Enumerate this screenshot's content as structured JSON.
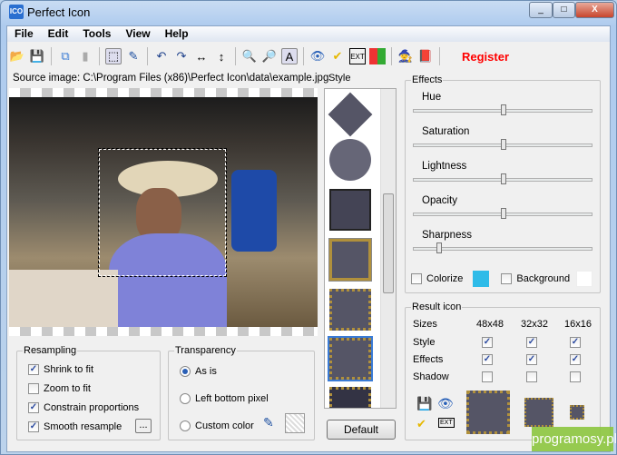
{
  "window": {
    "title": "Perfect Icon",
    "min": "_",
    "max": "□",
    "close": "X"
  },
  "menu": [
    "File",
    "Edit",
    "Tools",
    "View",
    "Help"
  ],
  "toolbar": {
    "register": "Register",
    "register_color": "#ff0000"
  },
  "source": {
    "label": "Source image: C:\\Program Files (x86)\\Perfect Icon\\data\\example.jpg"
  },
  "style": {
    "label": "Style",
    "default_button": "Default"
  },
  "effects": {
    "label": "Effects",
    "sliders": [
      {
        "name": "Hue",
        "value": 50
      },
      {
        "name": "Saturation",
        "value": 50
      },
      {
        "name": "Lightness",
        "value": 50
      },
      {
        "name": "Opacity",
        "value": 50
      },
      {
        "name": "Sharpness",
        "value": 13
      }
    ],
    "colorize": "Colorize",
    "colorize_color": "#2ebbe8",
    "background": "Background",
    "background_color": "#ffffff"
  },
  "result": {
    "label": "Result icon",
    "sizes_label": "Sizes",
    "sizes": [
      "48x48",
      "32x32",
      "16x16"
    ],
    "rows": [
      {
        "label": "Style",
        "checks": [
          true,
          true,
          true
        ]
      },
      {
        "label": "Effects",
        "checks": [
          true,
          true,
          true
        ]
      },
      {
        "label": "Shadow",
        "checks": [
          false,
          false,
          false
        ]
      }
    ]
  },
  "resampling": {
    "label": "Resampling",
    "options": [
      {
        "label": "Shrink to fit",
        "checked": true
      },
      {
        "label": "Zoom to fit",
        "checked": false
      },
      {
        "label": "Constrain proportions",
        "checked": true
      },
      {
        "label": "Smooth resample",
        "checked": true
      }
    ],
    "more": "..."
  },
  "transparency": {
    "label": "Transparency",
    "options": [
      {
        "label": "As is",
        "selected": true
      },
      {
        "label": "Left bottom pixel",
        "selected": false
      },
      {
        "label": "Custom color",
        "selected": false
      }
    ]
  },
  "watermark": "programosy.pl"
}
